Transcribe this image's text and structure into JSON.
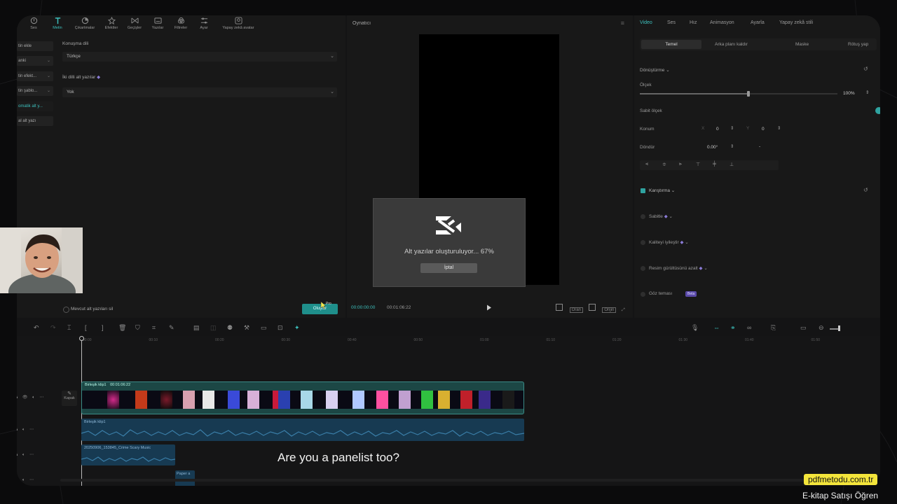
{
  "toolbar": {
    "items": [
      {
        "label": "Ses",
        "icon": "audio-icon"
      },
      {
        "label": "Metin",
        "icon": "text-icon",
        "active": true
      },
      {
        "label": "Çıkartmalar",
        "icon": "sticker-icon"
      },
      {
        "label": "Efektler",
        "icon": "effects-icon"
      },
      {
        "label": "Geçişler",
        "icon": "transitions-icon"
      },
      {
        "label": "Yazılar",
        "icon": "captions-icon"
      },
      {
        "label": "Filtreler",
        "icon": "filters-icon"
      },
      {
        "label": "Ayar",
        "icon": "adjust-icon"
      },
      {
        "label": "Yapay zekâ avatar",
        "icon": "avatar-icon"
      }
    ]
  },
  "sidebar": {
    "items": [
      {
        "label": "tin ekle"
      },
      {
        "label": "anki"
      },
      {
        "label": "tin efekt..."
      },
      {
        "label": "tin şablo..."
      },
      {
        "label": "omatik alt y...",
        "active": true
      },
      {
        "label": "al alt yazı"
      }
    ]
  },
  "caption_settings": {
    "language_label": "Konuşma dili",
    "language_value": "Türkçe",
    "bilingual_label": "İki dilli alt yazılar",
    "bilingual_value": "Yok",
    "delete_existing_label": "Mevcut alt yazıları sil",
    "generate_button": "Oluştur",
    "pro_badge": "Pro"
  },
  "player": {
    "title": "Oynatıcı",
    "current_time": "00:00:00:00",
    "total_time": "00:01:06:22",
    "ratio_label": "Oran",
    "orig_label": "Orijin"
  },
  "progress_dialog": {
    "message": "Alt yazılar oluşturuluyor... 67%",
    "progress": 0.67,
    "cancel_label": "İptal"
  },
  "inspector": {
    "tabs": [
      "Video",
      "Ses",
      "Hız",
      "Animasyon",
      "Ayarla",
      "Yapay zekâ stili"
    ],
    "subtabs": [
      "Temel",
      "Arka planı kaldır",
      "Maske",
      "Rötuş yap"
    ],
    "transform_label": "Dönüştürme",
    "scale_label": "Ölçek",
    "scale_value": "100%",
    "scale_fraction": 0.55,
    "uniform_label": "Sabit ölçek",
    "position_label": "Konum",
    "position_x_label": "X",
    "position_x": "0",
    "position_y_label": "Y",
    "position_y": "0",
    "rotate_label": "Döndür",
    "rotate_value": "0.00°",
    "rotate_dash": "-",
    "blend_label": "Karıştırma",
    "stabilize_label": "Sabitle",
    "quality_label": "Kaliteyi iyileştir",
    "denoise_label": "Resim gürültüsünü azalt",
    "eye_label": "Göz teması",
    "eye_badge": "Beta"
  },
  "timeline": {
    "ticks": [
      "00:00",
      "00:10",
      "00:20",
      "00:30",
      "00:40",
      "00:50",
      "01:00",
      "01:10",
      "01:20",
      "01:30",
      "01:40",
      "01:50"
    ],
    "cover_label": "Kapak",
    "video_clip_name": "Birleşik klip1",
    "video_clip_duration": "00:01:06:22",
    "audio_clip_name": "Birleşik klip1",
    "music_clip_name": "20250906_153845_Crime Scary Music",
    "sfx_clip_name": "Paper a"
  },
  "subtitle_overlay": "Are you a panelist too?",
  "watermark": {
    "site": "pdfmetodu.com.tr",
    "tagline": "E-kitap Satışı Öğren",
    "badge_color": "#f4e53b"
  },
  "colors": {
    "accent": "#3dc0bd",
    "panel_bg": "#181818",
    "dialog_bg": "#3a3a3a"
  }
}
